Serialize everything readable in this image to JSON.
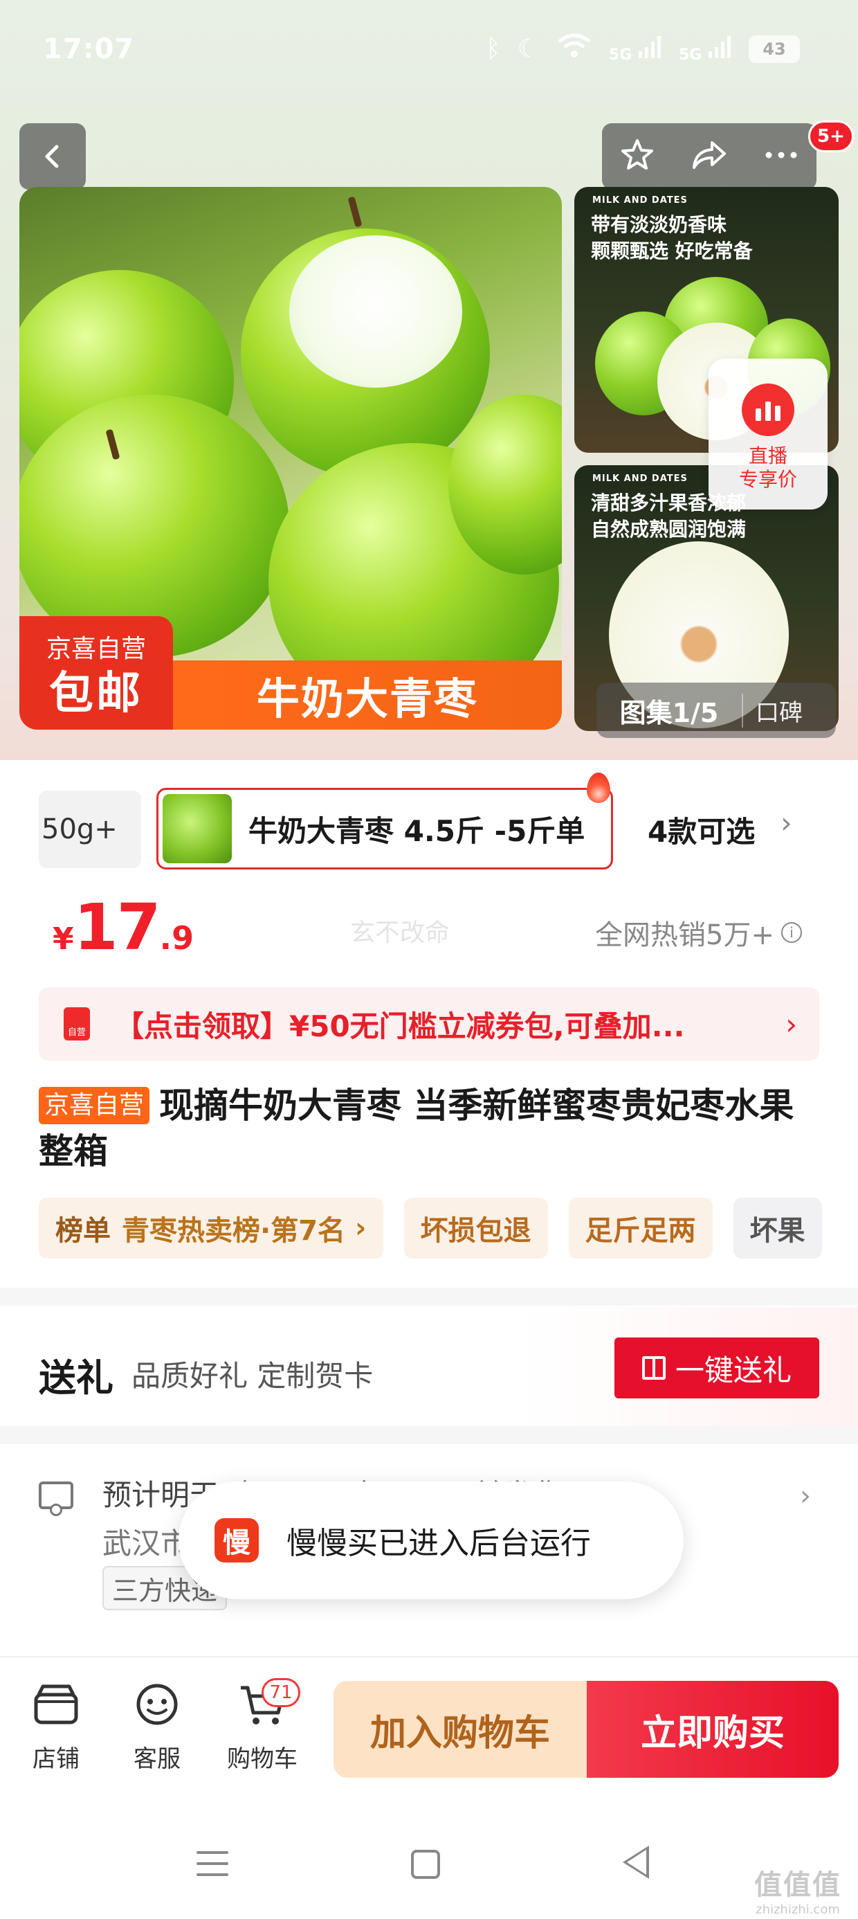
{
  "status_bar": {
    "time": "17:07",
    "network": "5G",
    "battery": "43"
  },
  "header": {
    "more_badge": "5+"
  },
  "gallery": {
    "main_tag_top": "京喜自营",
    "main_tag_bottom": "包邮",
    "main_name": "牛奶大青枣",
    "thumb1_mark": "MILK AND DATES",
    "thumb1_caption_line1": "带有淡淡奶香味",
    "thumb1_caption_line2": "颗颗甄选 好吃常备",
    "thumb2_mark": "MILK AND DATES",
    "thumb2_caption_line1": "清甜多汁果香浓郁",
    "thumb2_caption_line2": "自然成熟圆润饱满",
    "counter": "图集1/5",
    "word_of_mouth": "口碑",
    "live_line1": "直播",
    "live_line2": "专享价"
  },
  "sku": {
    "prev_option": "50g+",
    "selected_option": "牛奶大青枣 4.5斤 -5斤单",
    "more_options": "4款可选"
  },
  "price": {
    "currency": "¥",
    "integer": "17",
    "decimal": ".9",
    "watermark": "玄不改命",
    "sales": "全网热销5万+"
  },
  "coupon": {
    "icon_text": "自营",
    "text": "【点击领取】¥50无门槛立减券包,可叠加..."
  },
  "product": {
    "badge": "京喜自营",
    "title": "现摘牛奶大青枣 当季新鲜蜜枣贵妃枣水果整箱"
  },
  "tags": {
    "rank_key": "榜单",
    "rank_value": "青枣热卖榜·第7名",
    "t1": "坏损包退",
    "t2": "足斤足两",
    "t3": "坏果"
  },
  "gift": {
    "title": "送礼",
    "subtitle": "品质好礼 定制贺卡",
    "button": "一键送礼"
  },
  "delivery": {
    "line1": "预计明天（9月19日）24:00前发货",
    "line2": "武汉市",
    "tag": "三方快递"
  },
  "toast": {
    "icon": "慢",
    "text": "慢慢买已进入后台运行"
  },
  "bottom_bar": {
    "shop": "店铺",
    "service": "客服",
    "cart": "购物车",
    "cart_count": "71",
    "add_to_cart": "加入购物车",
    "buy_now": "立即购买"
  },
  "watermark": {
    "name": "值值值",
    "site": "zhizhizhi.com"
  }
}
